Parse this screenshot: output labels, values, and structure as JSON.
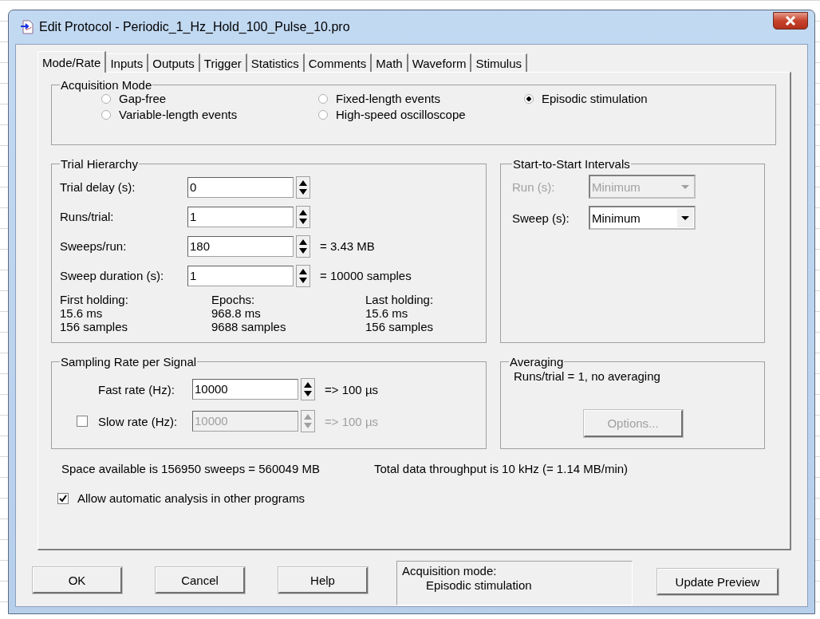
{
  "window": {
    "title": "Edit Protocol - Periodic_1_Hz_Hold_100_Pulse_10.pro"
  },
  "tabs": [
    {
      "label": "Mode/Rate",
      "selected": true
    },
    {
      "label": "Inputs",
      "selected": false
    },
    {
      "label": "Outputs",
      "selected": false
    },
    {
      "label": "Trigger",
      "selected": false
    },
    {
      "label": "Statistics",
      "selected": false
    },
    {
      "label": "Comments",
      "selected": false
    },
    {
      "label": "Math",
      "selected": false
    },
    {
      "label": "Waveform",
      "selected": false
    },
    {
      "label": "Stimulus",
      "selected": false
    }
  ],
  "acquisition_mode": {
    "title": "Acquisition Mode",
    "options": [
      {
        "label": "Gap-free",
        "selected": false
      },
      {
        "label": "Fixed-length events",
        "selected": false
      },
      {
        "label": "Episodic stimulation",
        "selected": true
      },
      {
        "label": "Variable-length events",
        "selected": false
      },
      {
        "label": "High-speed oscilloscope",
        "selected": false
      }
    ]
  },
  "trial_hierarchy": {
    "title": "Trial Hierarchy",
    "fields": [
      {
        "label": "Trial delay (s):",
        "value": "0"
      },
      {
        "label": "Runs/trial:",
        "value": "1"
      },
      {
        "label": "Sweeps/run:",
        "value": "180",
        "note": "= 3.43 MB"
      },
      {
        "label": "Sweep duration (s):",
        "value": "1",
        "note": "= 10000 samples"
      }
    ],
    "stats": [
      {
        "title": "First holding:",
        "lines": [
          "15.6 ms",
          "156 samples"
        ]
      },
      {
        "title": "Epochs:",
        "lines": [
          "968.8 ms",
          "9688 samples"
        ]
      },
      {
        "title": "Last holding:",
        "lines": [
          "15.6 ms",
          "156 samples"
        ]
      }
    ]
  },
  "start_intervals": {
    "title": "Start-to-Start Intervals",
    "fields": [
      {
        "label": "Run (s):",
        "value": "Minimum",
        "disabled": true
      },
      {
        "label": "Sweep (s):",
        "value": "Minimum",
        "disabled": false
      }
    ]
  },
  "sampling": {
    "title": "Sampling Rate per Signal",
    "fields": [
      {
        "kind": "plain",
        "label": "Fast rate  (Hz):",
        "value": "10000",
        "note": "=> 100 µs",
        "disabled": false
      },
      {
        "kind": "checkbox",
        "checked": false,
        "label": "Slow rate (Hz):",
        "value": "10000",
        "note": "=> 100 µs",
        "disabled": true
      }
    ]
  },
  "averaging": {
    "title": "Averaging",
    "text": "Runs/trial = 1, no averaging",
    "button": {
      "label": "Options...",
      "disabled": true
    }
  },
  "space_text": "Space available is 156950 sweeps = 560049 MB",
  "throughput_text": "Total data throughput is 10 kHz (= 1.14 MB/min)",
  "allow_analysis": {
    "label": "Allow automatic analysis in other programs",
    "checked": true
  },
  "buttons": [
    "OK",
    "Cancel",
    "Help"
  ],
  "mode_box": {
    "label": "Acquisition mode:",
    "value": "Episodic stimulation"
  },
  "update_button": "Update Preview"
}
